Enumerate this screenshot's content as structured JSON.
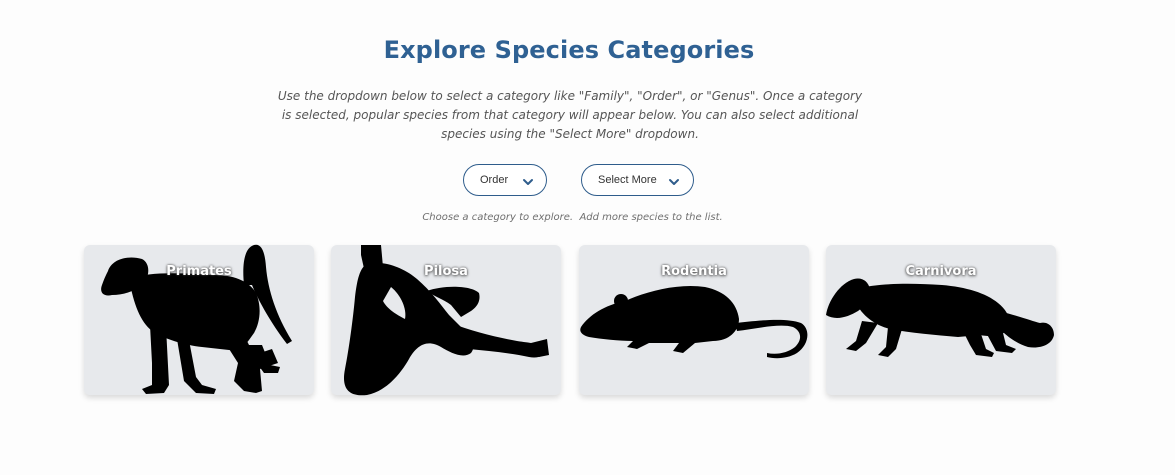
{
  "header": {
    "title": "Explore Species Categories",
    "description": "Use the dropdown below to select a category like \"Family\", \"Order\", or \"Genus\". Once a category is selected, popular species from that category will appear below. You can also select additional species using the \"Select More\" dropdown."
  },
  "controls": {
    "category_dropdown": {
      "selected": "Order"
    },
    "select_more_dropdown": {
      "label": "Select More"
    },
    "hint_category": "Choose a category to explore.",
    "hint_more": "Add more species to the list."
  },
  "cards": [
    {
      "label": "Primates",
      "icon": "baboon-silhouette-icon"
    },
    {
      "label": "Pilosa",
      "icon": "sloth-silhouette-icon"
    },
    {
      "label": "Rodentia",
      "icon": "rat-silhouette-icon"
    },
    {
      "label": "Carnivora",
      "icon": "marten-silhouette-icon"
    }
  ],
  "colors": {
    "title": "#2f6193",
    "card_bg": "#e7e9ec",
    "dropdown_border": "#2f5d8c",
    "silhouette": "#000000"
  }
}
